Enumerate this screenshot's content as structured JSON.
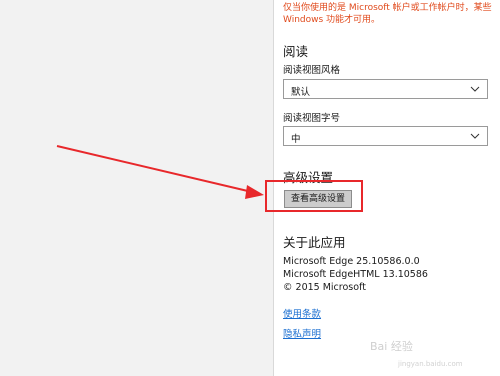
{
  "notice": {
    "line1": "仅当你使用的是 Microsoft 帐户或工作帐户时，某些",
    "line2": "Windows 功能才可用。"
  },
  "reading": {
    "heading": "阅读",
    "style_label": "阅读视图风格",
    "style_value": "默认",
    "font_label": "阅读视图字号",
    "font_value": "中"
  },
  "advanced": {
    "heading": "高级设置",
    "button_label": "查看高级设置"
  },
  "about": {
    "heading": "关于此应用",
    "edge_version": "Microsoft Edge 25.10586.0.0",
    "edgehtml_version": "Microsoft EdgeHTML 13.10586",
    "copyright": "© 2015 Microsoft",
    "terms_link": "使用条款",
    "privacy_link": "隐私声明"
  },
  "watermark": {
    "brand": "Bai 经验",
    "url": "jingyan.baidu.com"
  },
  "colors": {
    "annotation": "#e8282b",
    "notice": "#e04a1c",
    "link": "#1a6ed0"
  },
  "icons": [
    "chevron-down-icon",
    "annotation-arrow-icon"
  ]
}
